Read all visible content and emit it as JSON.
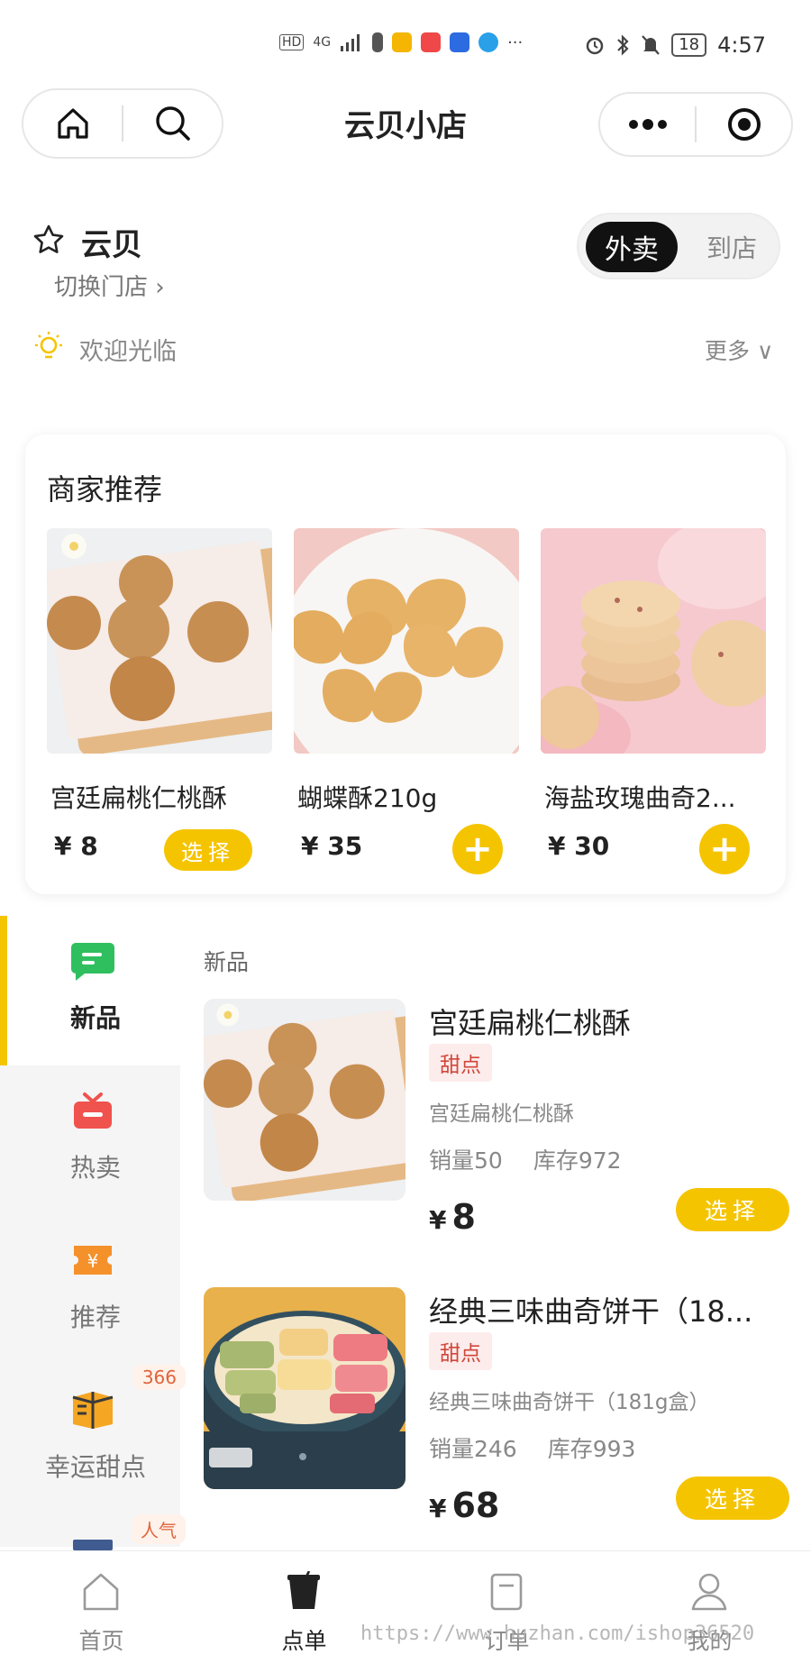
{
  "status_bar": {
    "network": "4G",
    "signal": "HD",
    "battery": "18",
    "time": "4:57"
  },
  "nav": {
    "title": "云贝小店"
  },
  "store": {
    "name": "云贝",
    "switch_label": "切换门店 ›",
    "modes": [
      "外卖",
      "到店"
    ],
    "welcome": "欢迎光临",
    "more_label": "更多 ∨"
  },
  "recommend": {
    "title": "商家推荐",
    "items": [
      {
        "name": "宫廷扁桃仁桃酥",
        "price": "¥ 8",
        "action": "选择"
      },
      {
        "name": "蝴蝶酥210g",
        "price": "¥ 35",
        "action": "+"
      },
      {
        "name": "海盐玫瑰曲奇2...",
        "price": "¥ 30",
        "action": "+"
      }
    ]
  },
  "categories": [
    {
      "label": "新品",
      "icon": "chat-icon",
      "color": "#2fbf5f"
    },
    {
      "label": "热卖",
      "icon": "gift-icon",
      "color": "#f0524d"
    },
    {
      "label": "推荐",
      "icon": "coupon-icon",
      "color": "#f5912b"
    },
    {
      "label": "幸运甜点",
      "icon": "box-icon",
      "color": "#f5a623",
      "badge": "366"
    },
    {
      "label": "",
      "icon": "box-icon",
      "color": "#3f5b8f",
      "badge": "人气"
    }
  ],
  "section": {
    "title": "新品"
  },
  "products": [
    {
      "name": "宫廷扁桃仁桃酥",
      "tag": "甜点",
      "desc": "宫廷扁桃仁桃酥",
      "sales": "销量50",
      "stock": "库存972",
      "currency": "¥",
      "price": "8",
      "action": "选择"
    },
    {
      "name": "经典三味曲奇饼干（18...",
      "tag": "甜点",
      "desc": "经典三味曲奇饼干（181g盒）",
      "sales": "销量246",
      "stock": "库存993",
      "currency": "¥",
      "price": "68",
      "action": "选择"
    }
  ],
  "tabs": [
    {
      "label": "首页",
      "icon": "home-icon"
    },
    {
      "label": "点单",
      "icon": "cup-icon"
    },
    {
      "label": "订单",
      "icon": "order-icon"
    },
    {
      "label": "我的",
      "icon": "profile-icon"
    }
  ],
  "watermark": "https://www.huzhan.com/ishop36520",
  "colors": {
    "accent": "#f5c400",
    "tag_bg": "#fdecec",
    "tag_text": "#d0473a"
  }
}
